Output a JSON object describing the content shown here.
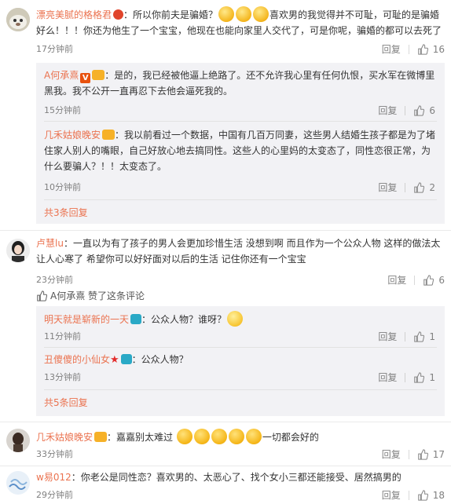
{
  "comments": [
    {
      "user": "漂亮美腻的格格君",
      "text_a": "：所以你前夫是骗婚？",
      "text_b": "喜欢男的我觉得并不可耻，可耻的是骗婚好么！！！你还为他生了一个宝宝，他现在也能向家里人交代了，可是你呢，骗婚的都可以去死了",
      "time": "17分钟前",
      "reply_label": "回复",
      "likes": "16",
      "replies": [
        {
          "user": "A何承熹",
          "text": "：是的，我已经被他逼上绝路了。还不允许我心里有任何仇恨，买水军在微博里黑我。我不公开一直再忍下去他会逼死我的。",
          "time": "15分钟前",
          "reply_label": "回复",
          "likes": "6"
        },
        {
          "user": "几禾姑娘晚安",
          "text": "：我以前看过一个数据，中国有几百万同妻，这些男人结婚生孩子都是为了堵住家人别人的嘴眼，自己好放心地去搞同性。这些人的心里妈的太变态了，同性恋很正常，为什么要骗人？！！太变态了。",
          "time": "10分钟前",
          "reply_label": "回复",
          "likes": "2"
        }
      ],
      "more_replies": "共3条回复"
    },
    {
      "user": "卢慧lu",
      "text": "：一直以为有了孩子的男人会更加珍惜生活 没想到啊 而且作为一个公众人物 这样的做法太让人心寒了 希望你可以好好面对以后的生活 记住你还有一个宝宝",
      "time": "23分钟前",
      "reply_label": "回复",
      "likes": "6",
      "liked_by": "A何承熹 赞了这条评论",
      "replies": [
        {
          "user": "明天就是崭新的一天",
          "text": "：公众人物？谁呀？",
          "time": "11分钟前",
          "reply_label": "回复",
          "likes": "1"
        },
        {
          "user": "丑傻傻的小仙女",
          "text": "：公众人物？",
          "time": "13分钟前",
          "reply_label": "回复",
          "likes": "1"
        }
      ],
      "more_replies": "共5条回复"
    },
    {
      "user": "几禾姑娘晚安",
      "text_a": "：嘉嘉别太难过",
      "text_b": "一切都会好的",
      "time": "33分钟前",
      "reply_label": "回复",
      "likes": "17"
    },
    {
      "user": "w易012",
      "text": "：你老公是同性恋？喜欢男的、太恶心了、找个女小三都还能接受、居然搞男的",
      "time": "29分钟前",
      "reply_label": "回复",
      "likes": "18"
    }
  ],
  "badges": {
    "v_label": "V"
  },
  "colors": {
    "username": "#eb7350",
    "link_blue": "#3b82c4",
    "reply_bg": "#f2f2f5"
  }
}
